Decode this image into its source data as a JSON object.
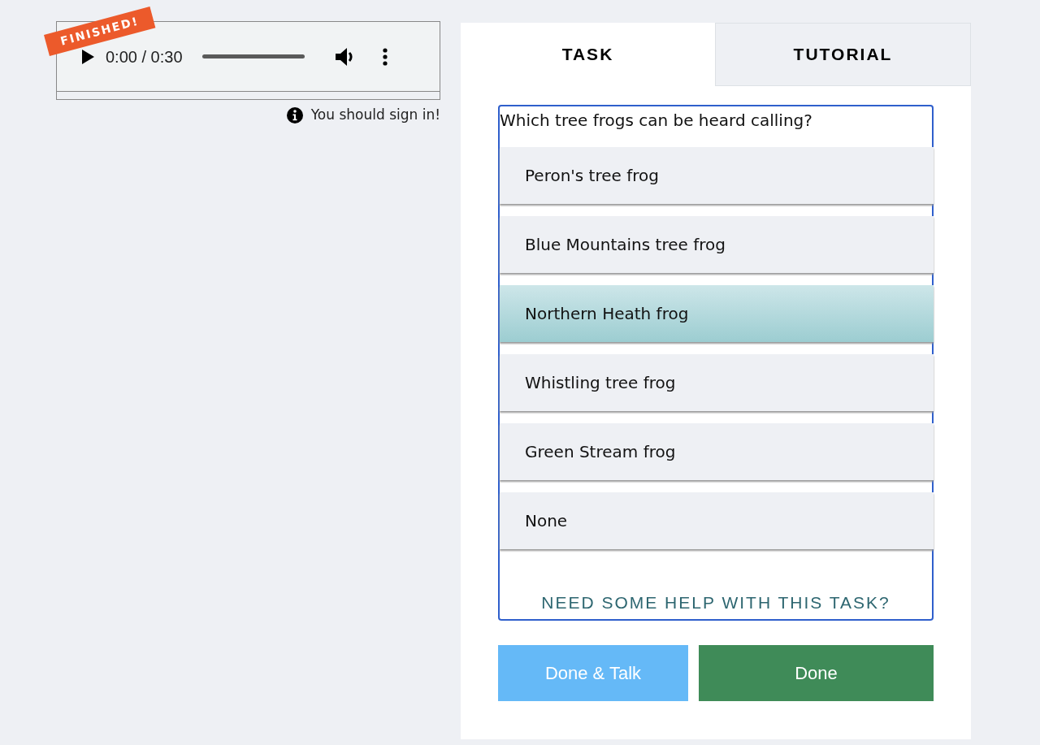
{
  "audio_player": {
    "badge": "FINISHED!",
    "time": "0:00 / 0:30"
  },
  "notice": "You should sign in!",
  "tabs": [
    {
      "label": "TASK",
      "selected": true
    },
    {
      "label": "TUTORIAL",
      "selected": false
    }
  ],
  "question": "Which tree frogs can be heard calling?",
  "answers": [
    {
      "label": "Peron's tree frog",
      "selected": false
    },
    {
      "label": "Blue Mountains tree frog",
      "selected": false
    },
    {
      "label": "Northern Heath frog",
      "selected": true
    },
    {
      "label": "Whistling tree frog",
      "selected": false
    },
    {
      "label": "Green Stream frog",
      "selected": false
    },
    {
      "label": "None",
      "selected": false
    }
  ],
  "help_link": "NEED SOME HELP WITH THIS TASK?",
  "buttons": [
    {
      "label": "Done & Talk",
      "kind": "secondary"
    },
    {
      "label": "Done",
      "kind": "primary"
    }
  ]
}
